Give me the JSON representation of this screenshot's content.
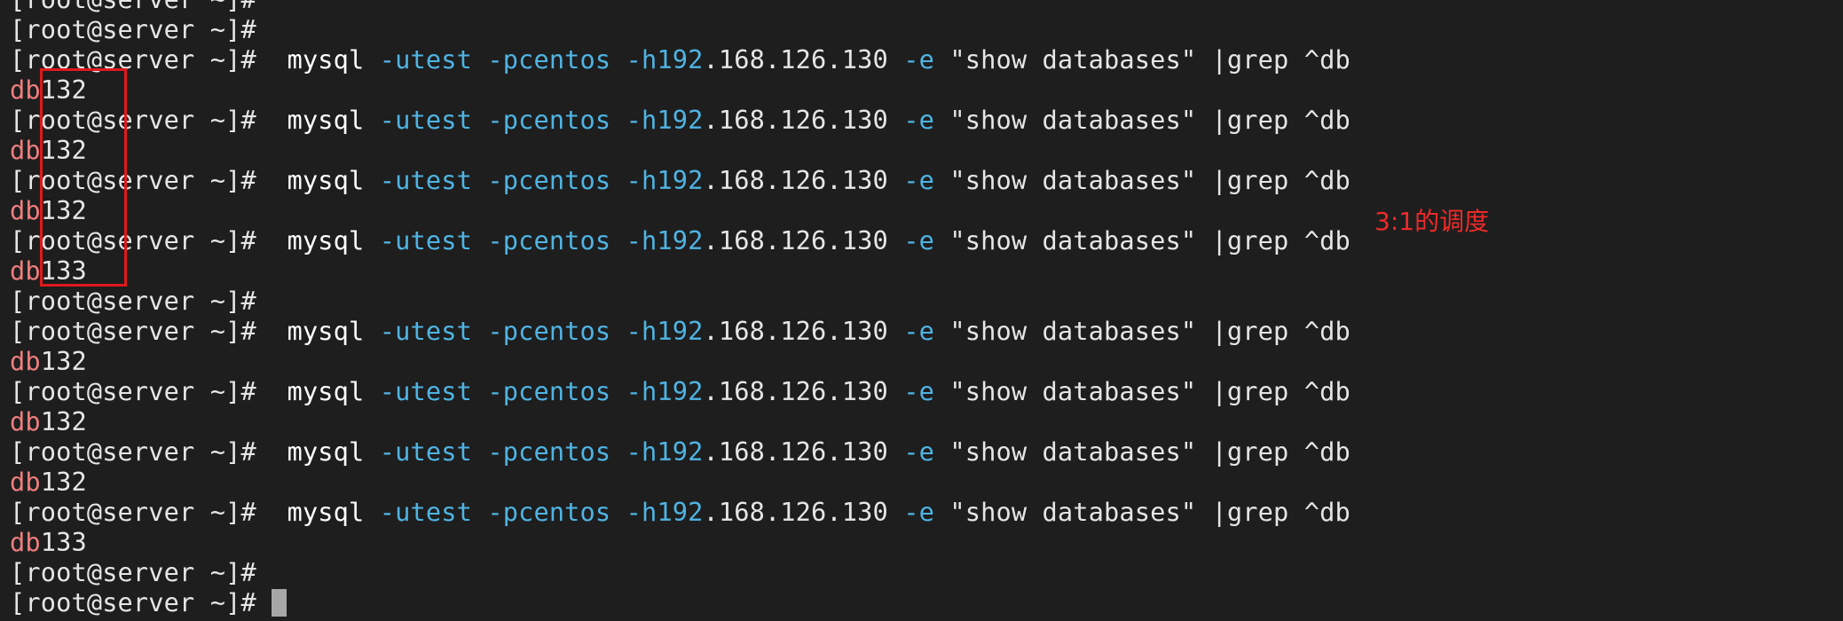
{
  "terminal": {
    "lines": [
      {
        "type": "prompt",
        "text": "[root@server ~]#"
      },
      {
        "type": "prompt",
        "text": "[root@server ~]#"
      },
      {
        "type": "command",
        "prompt": "[root@server ~]#",
        "cmd": "mysql",
        "user_opt": "-utest",
        "pass_opt": "-pcentos",
        "host_opt": "-h192",
        "host_rest": ".168.126.130",
        "exec_opt": "-e",
        "query": "\"show databases\" |grep ^db"
      },
      {
        "type": "output",
        "prefix": "db",
        "num": "132"
      },
      {
        "type": "command",
        "prompt": "[root@server ~]#",
        "cmd": "mysql",
        "user_opt": "-utest",
        "pass_opt": "-pcentos",
        "host_opt": "-h192",
        "host_rest": ".168.126.130",
        "exec_opt": "-e",
        "query": "\"show databases\" |grep ^db"
      },
      {
        "type": "output",
        "prefix": "db",
        "num": "132"
      },
      {
        "type": "command",
        "prompt": "[root@server ~]#",
        "cmd": "mysql",
        "user_opt": "-utest",
        "pass_opt": "-pcentos",
        "host_opt": "-h192",
        "host_rest": ".168.126.130",
        "exec_opt": "-e",
        "query": "\"show databases\" |grep ^db"
      },
      {
        "type": "output",
        "prefix": "db",
        "num": "132"
      },
      {
        "type": "command",
        "prompt": "[root@server ~]#",
        "cmd": "mysql",
        "user_opt": "-utest",
        "pass_opt": "-pcentos",
        "host_opt": "-h192",
        "host_rest": ".168.126.130",
        "exec_opt": "-e",
        "query": "\"show databases\" |grep ^db"
      },
      {
        "type": "output",
        "prefix": "db",
        "num": "133"
      },
      {
        "type": "prompt",
        "text": "[root@server ~]#"
      },
      {
        "type": "command",
        "prompt": "[root@server ~]#",
        "cmd": "mysql",
        "user_opt": "-utest",
        "pass_opt": "-pcentos",
        "host_opt": "-h192",
        "host_rest": ".168.126.130",
        "exec_opt": "-e",
        "query": "\"show databases\" |grep ^db"
      },
      {
        "type": "output",
        "prefix": "db",
        "num": "132"
      },
      {
        "type": "command",
        "prompt": "[root@server ~]#",
        "cmd": "mysql",
        "user_opt": "-utest",
        "pass_opt": "-pcentos",
        "host_opt": "-h192",
        "host_rest": ".168.126.130",
        "exec_opt": "-e",
        "query": "\"show databases\" |grep ^db"
      },
      {
        "type": "output",
        "prefix": "db",
        "num": "132"
      },
      {
        "type": "command",
        "prompt": "[root@server ~]#",
        "cmd": "mysql",
        "user_opt": "-utest",
        "pass_opt": "-pcentos",
        "host_opt": "-h192",
        "host_rest": ".168.126.130",
        "exec_opt": "-e",
        "query": "\"show databases\" |grep ^db"
      },
      {
        "type": "output",
        "prefix": "db",
        "num": "132"
      },
      {
        "type": "command",
        "prompt": "[root@server ~]#",
        "cmd": "mysql",
        "user_opt": "-utest",
        "pass_opt": "-pcentos",
        "host_opt": "-h192",
        "host_rest": ".168.126.130",
        "exec_opt": "-e",
        "query": "\"show databases\" |grep ^db"
      },
      {
        "type": "output",
        "prefix": "db",
        "num": "133"
      },
      {
        "type": "prompt",
        "text": "[root@server ~]#"
      },
      {
        "type": "prompt",
        "text": "[root@server ~]#",
        "cursor": true
      }
    ]
  },
  "annotation": {
    "text": "3:1的调度"
  },
  "colors": {
    "background": "#1e1e1e",
    "text": "#e6e6e6",
    "option": "#4fb4e3",
    "db_prefix": "#f07f7f",
    "annotation": "#ef2a2a",
    "highlight_box": "#e0191b"
  }
}
